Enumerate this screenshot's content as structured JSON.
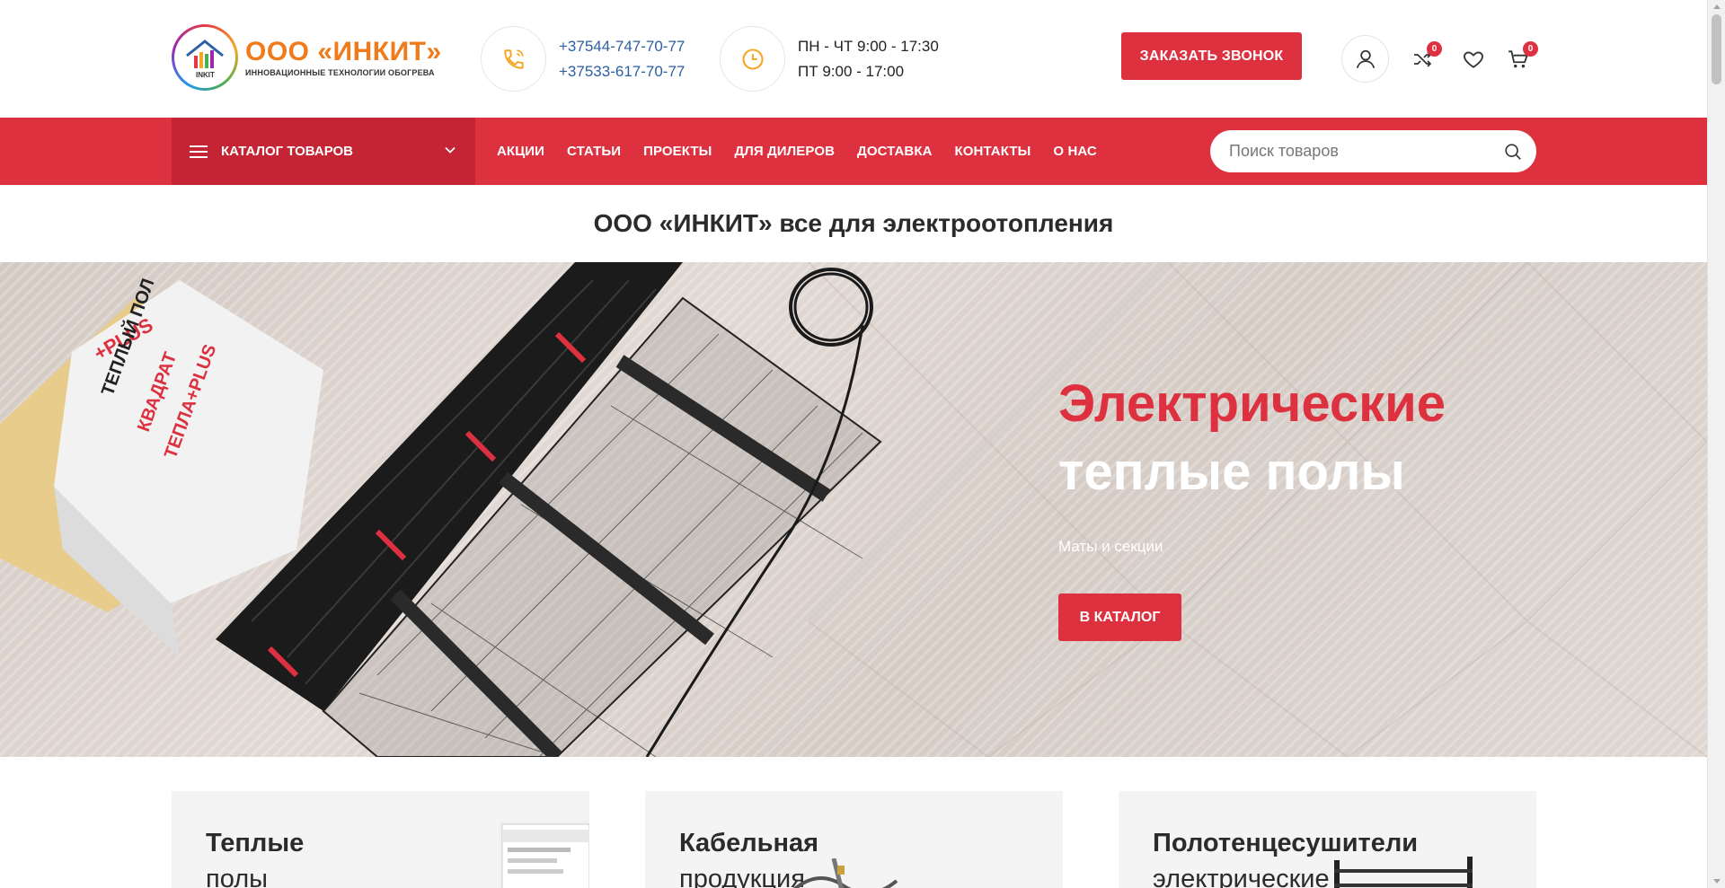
{
  "header": {
    "logo_title": "ООО «ИНКИТ»",
    "logo_subtitle": "ИННОВАЦИОННЫЕ ТЕХНОЛОГИИ ОБОГРЕВА",
    "logo_mark_text": "INKIT",
    "phones": [
      "+37544-747-70-77",
      "+37533-617-70-77"
    ],
    "hours": [
      "ПН - ЧТ 9:00 - 17:30",
      "ПТ 9:00 - 17:00"
    ],
    "callback_label": "ЗАКАЗАТЬ ЗВОНОК",
    "compare_count": "0",
    "cart_count": "0"
  },
  "nav": {
    "catalog_label": "КАТАЛОГ ТОВАРОВ",
    "items": [
      "АКЦИИ",
      "СТАТЬИ",
      "ПРОЕКТЫ",
      "ДЛЯ ДИЛЕРОВ",
      "ДОСТАВКА",
      "КОНТАКТЫ",
      "О НАС"
    ],
    "search_placeholder": "Поиск товаров"
  },
  "page_title": "ООО «ИНКИТ» все для электроотопления",
  "hero": {
    "title_line1": "Электрические",
    "title_line2": "теплые полы",
    "subtitle": "Маты и секции",
    "button_label": "В КАТАЛОГ",
    "box_text_plus": "+PLUS",
    "box_text_floor": "ТЕПЛЫЙ ПОЛ",
    "box_text_square": "КВАДРАТ",
    "box_text_heat": "ТЕПЛА+PLUS"
  },
  "categories": [
    {
      "title": "Теплые",
      "subtitle": "полы"
    },
    {
      "title": "Кабельная",
      "subtitle": "продукция"
    },
    {
      "title": "Полотенцесушители",
      "subtitle": "электрические"
    }
  ],
  "colors": {
    "accent": "#dd3140",
    "accent_dark": "#c42433",
    "logo_orange": "#f07b1a",
    "phone_blue": "#2c5fa3"
  }
}
